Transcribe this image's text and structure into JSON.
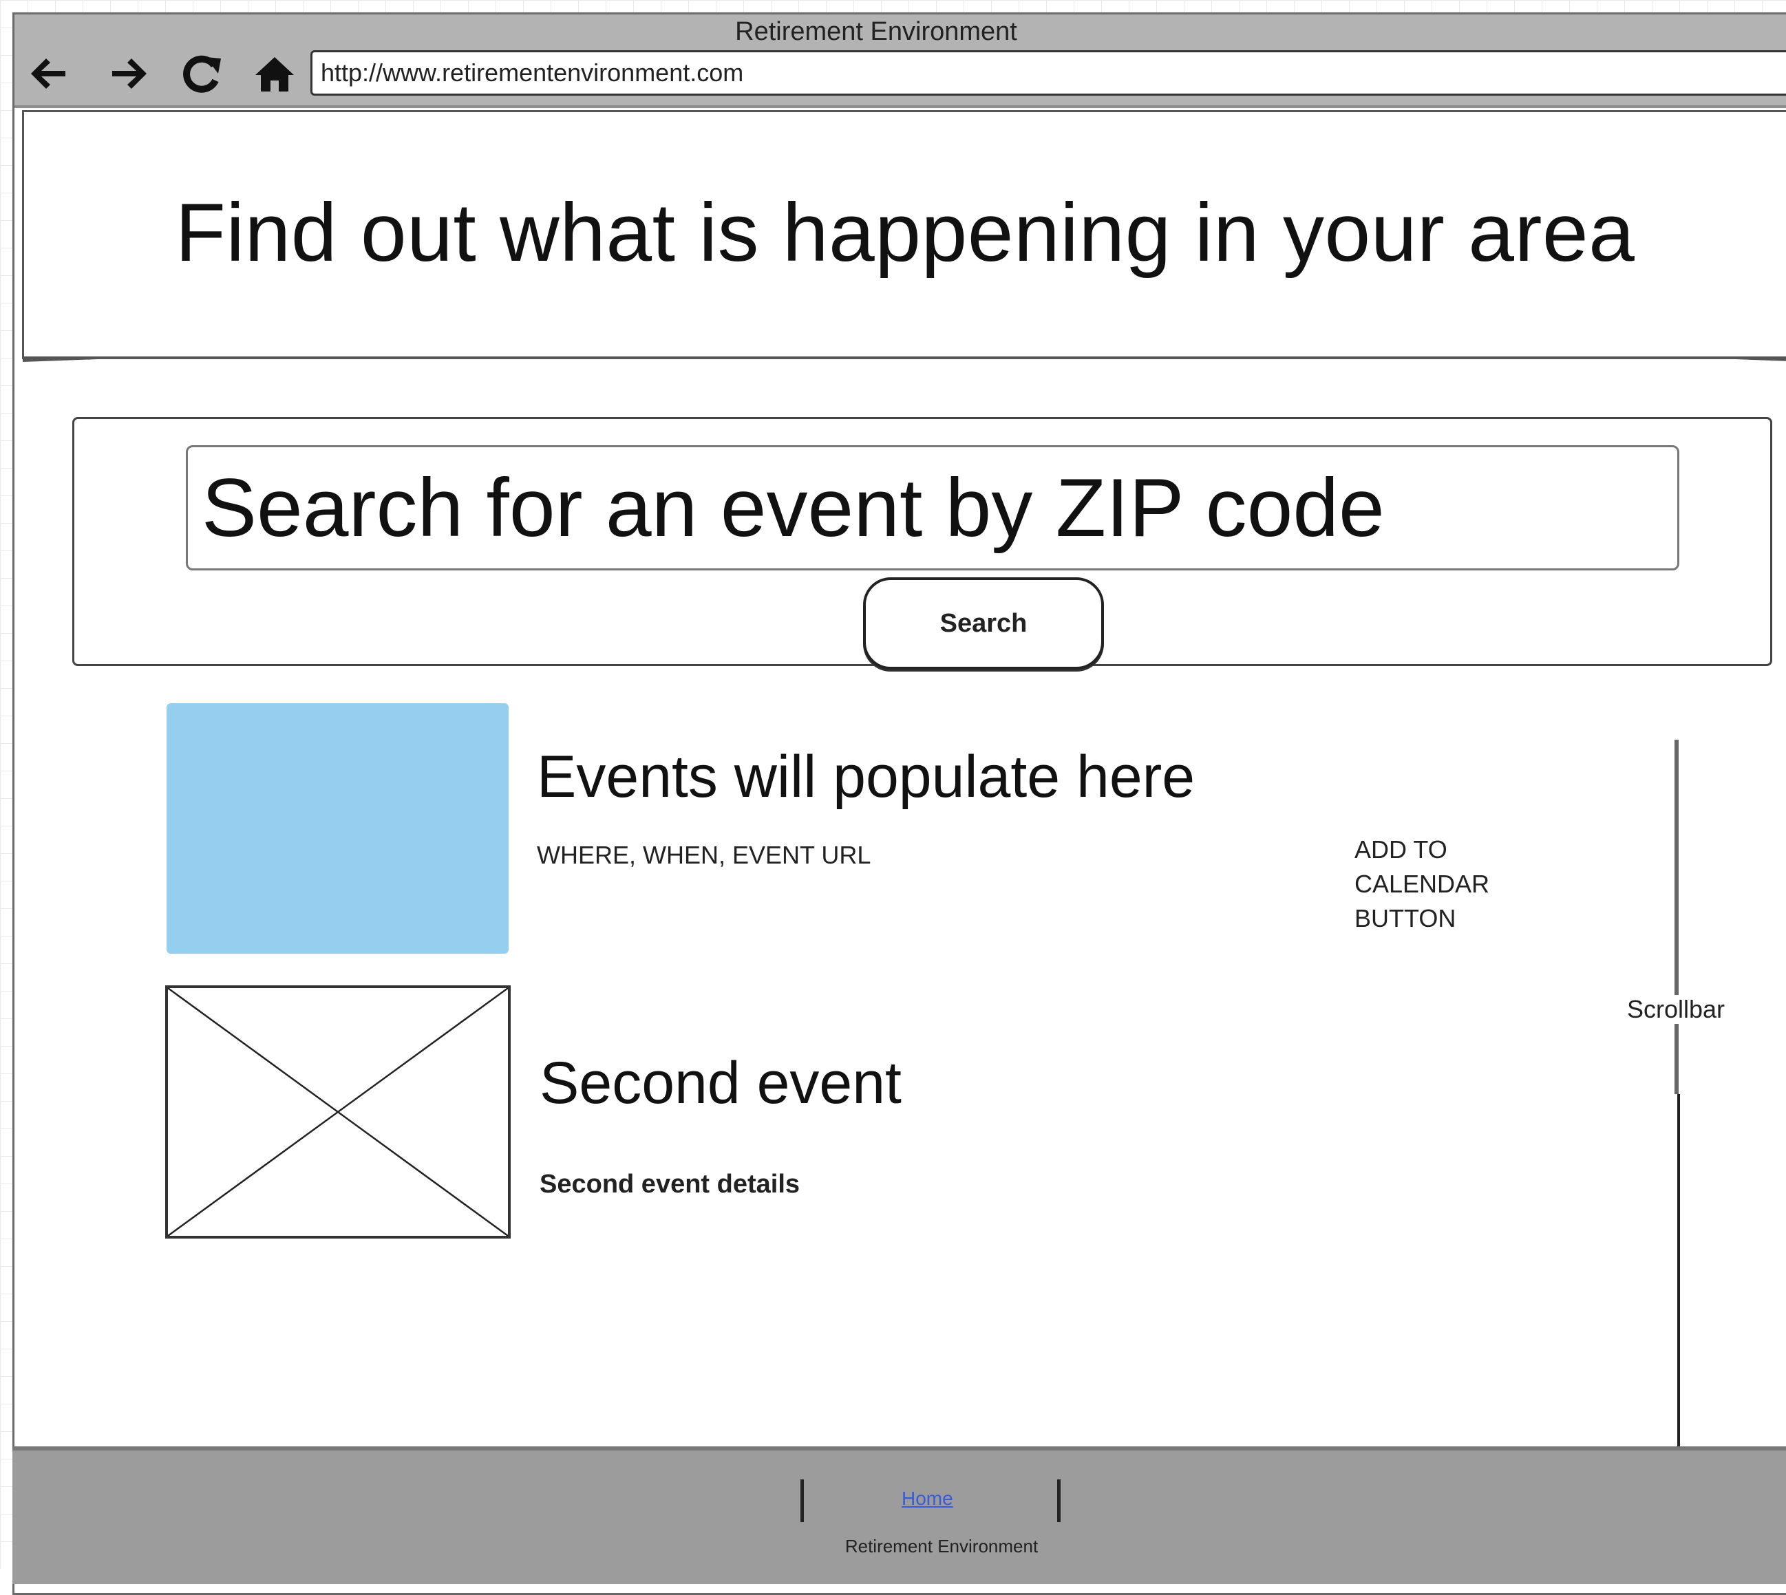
{
  "window": {
    "title": "Retirement Environment",
    "url": "http://www.retirementenvironment.com"
  },
  "nav": {
    "back_icon": "arrow-left-icon",
    "forward_icon": "arrow-right-icon",
    "refresh_icon": "refresh-icon",
    "home_icon": "home-icon"
  },
  "hero": {
    "title": "Find out what is happening in your area"
  },
  "search": {
    "placeholder": "Search for an event by ZIP code",
    "button_label": "Search"
  },
  "events": [
    {
      "title": "Events will populate here",
      "details": "WHERE, WHEN, EVENT URL",
      "image_color": "#94cff0"
    },
    {
      "title": "Second event",
      "details": "Second event details"
    }
  ],
  "add_to_calendar": {
    "line1": "ADD TO",
    "line2": "CALENDAR",
    "line3": "BUTTON"
  },
  "scrollbar_label": "Scrollbar",
  "footer": {
    "home_link": "Home",
    "brand": "Retirement Environment"
  }
}
